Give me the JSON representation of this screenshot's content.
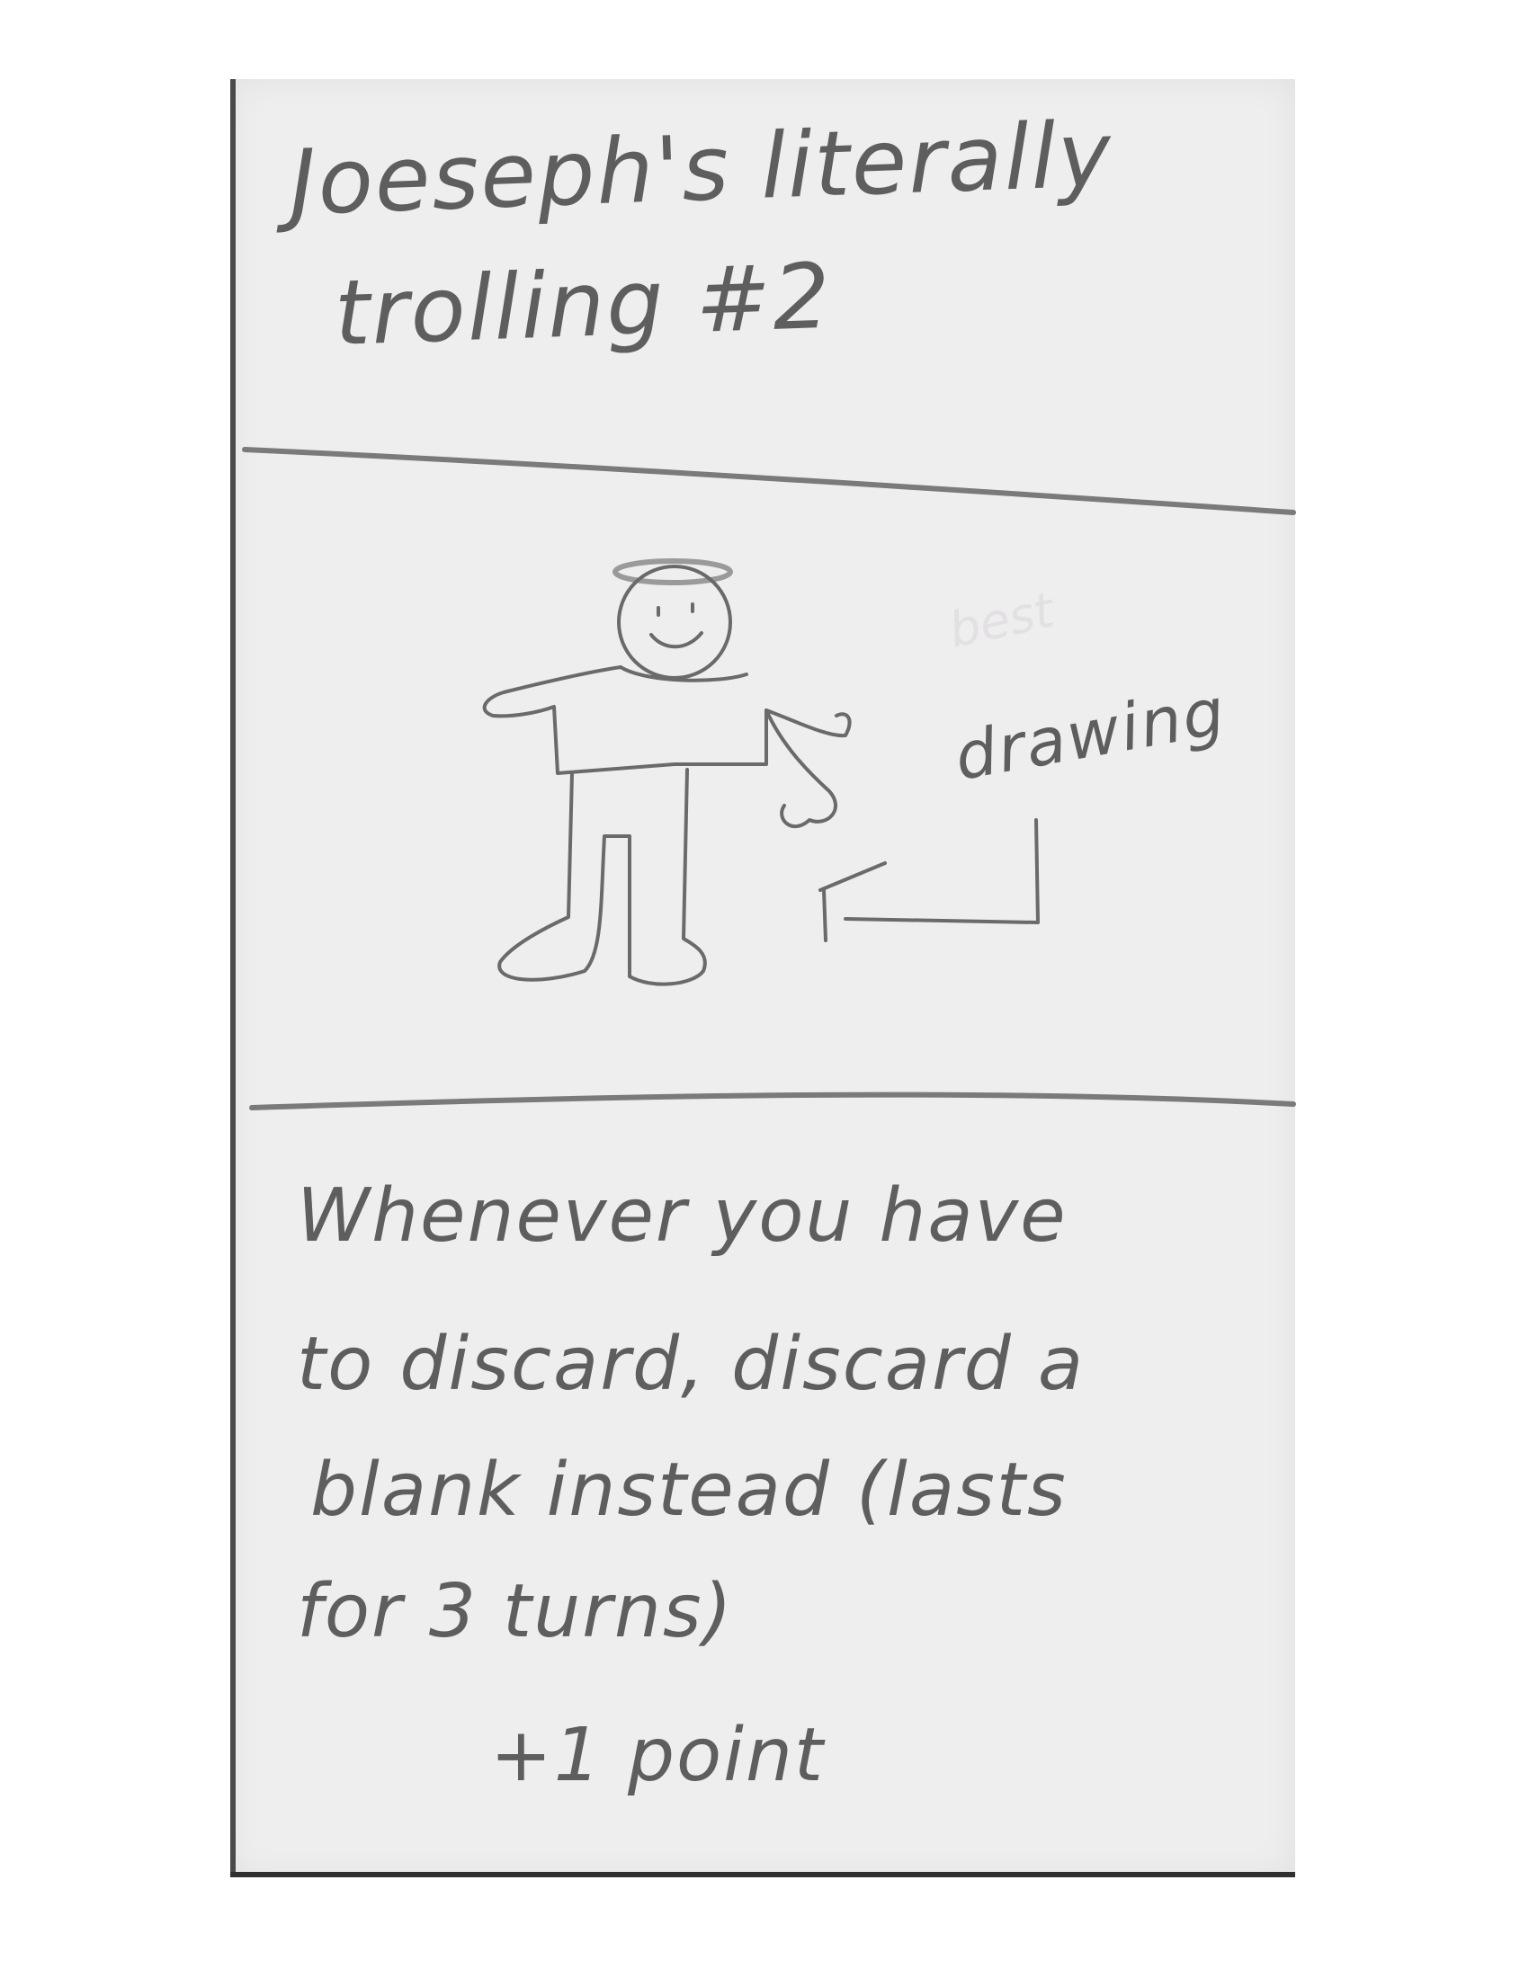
{
  "card": {
    "title_line1": "Joeseph's literally",
    "title_line2": "trolling #2",
    "drawing_label": "drawing",
    "rule_lines": [
      "Whenever you have",
      "to discard, discard a",
      "blank instead (lasts",
      "for 3 turns)"
    ],
    "points": "+1 point"
  },
  "colors": {
    "paper": "#efeeef",
    "pencil": "#5e5e5e",
    "background": "#ffffff"
  }
}
